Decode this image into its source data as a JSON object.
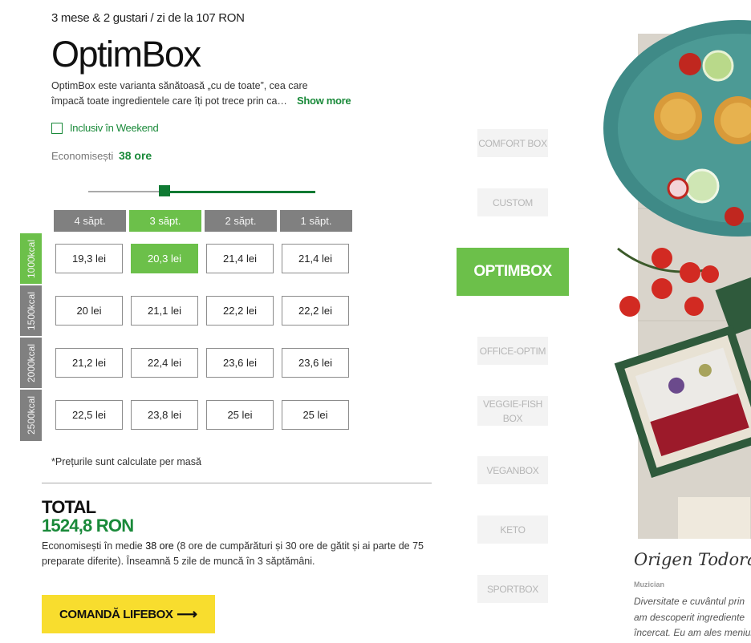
{
  "header": {
    "subtitle": "3 mese & 2 gustari / zi de la 107 RON",
    "title": "OptimBox",
    "description_line1": "OptimBox este varianta sănătoasă „cu de toate”, cea care",
    "description_line2": "împacă toate ingredientele care îți pot trece prin cap...",
    "show_more": "Show more"
  },
  "weekend_option": {
    "label": "Inclusiv în Weekend",
    "checked": false
  },
  "savings": {
    "label": "Economisești",
    "value": "38 ore"
  },
  "duration_slider": {
    "selected_weeks": 3,
    "min_weeks": 1,
    "max_weeks": 4
  },
  "week_tabs": [
    "4 săpt.",
    "3 săpt.",
    "2 săpt.",
    "1 săpt."
  ],
  "calorie_rows": [
    {
      "label": "1000kcal",
      "prices": [
        "19,3 lei",
        "20,3 lei",
        "21,4 lei",
        "21,4 lei"
      ]
    },
    {
      "label": "1500kcal",
      "prices": [
        "20 lei",
        "21,1 lei",
        "22,2 lei",
        "22,2 lei"
      ]
    },
    {
      "label": "2000kcal",
      "prices": [
        "21,2 lei",
        "22,4 lei",
        "23,6 lei",
        "23,6 lei"
      ]
    },
    {
      "label": "2500kcal",
      "prices": [
        "22,5 lei",
        "23,8 lei",
        "25 lei",
        "25 lei"
      ]
    }
  ],
  "selection": {
    "week_tab": "3 săpt.",
    "calorie_row": "1000kcal",
    "price": "20,3 lei"
  },
  "note": "*Prețurile sunt calculate per masă",
  "total": {
    "label": "TOTAL",
    "value": "1524,8 RON",
    "desc_prefix": "Economisești în medie",
    "desc_hours": "38 ore",
    "desc_suffix": "(8 ore de cumpărături și 30 ore de gătit și ai parte de 75 preparate diferite). Înseamnă 5 zile de muncă în 3 săptămâni."
  },
  "order_button": {
    "label": "COMANDĂ LIFEBOX",
    "icon": "arrow-right-icon"
  },
  "box_menu": {
    "items": [
      "COMFORT BOX",
      "CUSTOM",
      "OPTIMBOX",
      "OFFICE-OPTIM",
      "VEGGIE-FISH BOX",
      "VEGANBOX",
      "KETO",
      "SPORTBOX"
    ],
    "active": "OPTIMBOX"
  },
  "testimonial": {
    "name": "Origen Todoran",
    "role": "Muzician",
    "text_line1": "Diversitate e cuvântul prin",
    "text_line2": "am descoperit ingrediente",
    "text_line3": "încercat. Eu am ales meniul"
  },
  "colors": {
    "green_dark": "#1a8a3a",
    "green_light": "#6cc04a",
    "tab_gray": "#808080",
    "button_yellow": "#f8dd2e",
    "menu_inactive_bg": "#f3f3f3",
    "menu_inactive_text": "#b6b6b6"
  }
}
